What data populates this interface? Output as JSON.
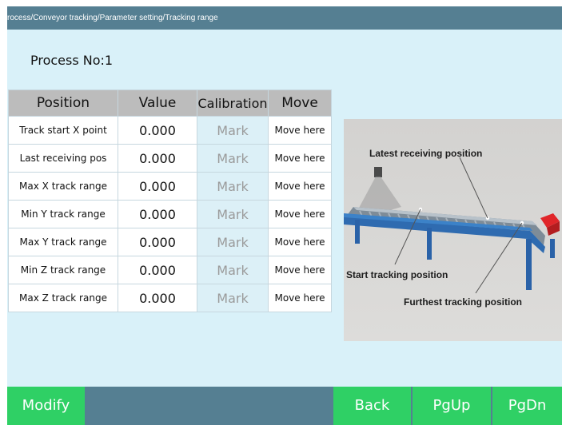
{
  "breadcrumb": "rocess/Conveyor tracking/Parameter setting/Tracking range",
  "process_label": "Process No:1",
  "table": {
    "headers": [
      "Position",
      "Value",
      "Calibration",
      "Move"
    ],
    "rows": [
      {
        "position": "Track start X point",
        "value": "0.000",
        "calibration": "Mark",
        "move": "Move here"
      },
      {
        "position": "Last receiving pos",
        "value": "0.000",
        "calibration": "Mark",
        "move": "Move here"
      },
      {
        "position": "Max X track range",
        "value": "0.000",
        "calibration": "Mark",
        "move": "Move here"
      },
      {
        "position": "Min Y track range",
        "value": "0.000",
        "calibration": "Mark",
        "move": "Move here"
      },
      {
        "position": "Max Y track range",
        "value": "0.000",
        "calibration": "Mark",
        "move": "Move here"
      },
      {
        "position": "Min Z track range",
        "value": "0.000",
        "calibration": "Mark",
        "move": "Move here"
      },
      {
        "position": "Max Z track range",
        "value": "0.000",
        "calibration": "Mark",
        "move": "Move here"
      }
    ]
  },
  "illustration": {
    "label_latest": "Latest receiving position",
    "label_start": "Start tracking position",
    "label_furthest": "Furthest tracking position"
  },
  "footer": {
    "modify": "Modify",
    "back": "Back",
    "pgup": "PgUp",
    "pgdn": "PgDn"
  },
  "colors": {
    "titlebar": "#557f92",
    "content_bg": "#d9f1f9",
    "button_green": "#2fd065",
    "header_gray": "#bcbcbc"
  }
}
